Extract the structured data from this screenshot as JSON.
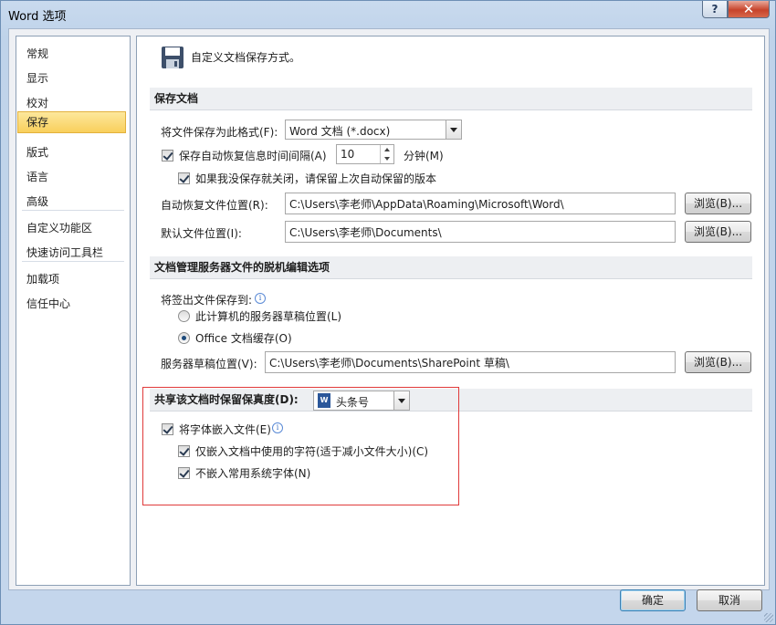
{
  "window": {
    "title": "Word 选项",
    "help_label": "?",
    "close_label": "✕"
  },
  "sidebar": {
    "items": [
      {
        "label": "常规"
      },
      {
        "label": "显示"
      },
      {
        "label": "校对"
      },
      {
        "label": "保存",
        "selected": true
      },
      {
        "label": "版式"
      },
      {
        "label": "语言"
      },
      {
        "label": "高级"
      },
      {
        "label": "自定义功能区"
      },
      {
        "label": "快速访问工具栏"
      },
      {
        "label": "加载项"
      },
      {
        "label": "信任中心"
      }
    ]
  },
  "header": {
    "text": "自定义文档保存方式。",
    "icon": "floppy-disk-icon"
  },
  "save_section": {
    "title": "保存文档",
    "format_label": "将文件保存为此格式(F):",
    "format_value": "Word 文档 (*.docx)",
    "autorecover_label": "保存自动恢复信息时间间隔(A)",
    "autorecover_checked": true,
    "autorecover_minutes": "10",
    "minutes_label": "分钟(M)",
    "keep_last_label": "如果我没保存就关闭，请保留上次自动保留的版本",
    "keep_last_checked": true,
    "autorecover_location_label": "自动恢复文件位置(R):",
    "autorecover_location_value": "C:\\Users\\李老师\\AppData\\Roaming\\Microsoft\\Word\\",
    "default_location_label": "默认文件位置(I):",
    "default_location_value": "C:\\Users\\李老师\\Documents\\",
    "browse_label": "浏览(B)..."
  },
  "offline_section": {
    "title": "文档管理服务器文件的脱机编辑选项",
    "checkout_label": "将签出文件保存到:",
    "option_server_drafts": "此计算机的服务器草稿位置(L)",
    "option_office_cache": "Office 文档缓存(O)",
    "selected_option": "Office 文档缓存(O)",
    "drafts_location_label": "服务器草稿位置(V):",
    "drafts_location_value": "C:\\Users\\李老师\\Documents\\SharePoint 草稿\\",
    "browse_label": "浏览(B)..."
  },
  "fidelity_section": {
    "title": "共享该文档时保留保真度(D):",
    "document_value": "头条号",
    "embed_fonts_label": "将字体嵌入文件(E)",
    "embed_fonts_checked": true,
    "embed_used_chars_label": "仅嵌入文档中使用的字符(适于减小文件大小)(C)",
    "embed_used_chars_checked": true,
    "no_common_fonts_label": "不嵌入常用系统字体(N)",
    "no_common_fonts_checked": true
  },
  "footer": {
    "ok_label": "确定",
    "cancel_label": "取消"
  },
  "colors": {
    "selected_nav": "#f9cf5c",
    "highlight_border": "#e03a3a",
    "section_bar": "#edeff2"
  }
}
